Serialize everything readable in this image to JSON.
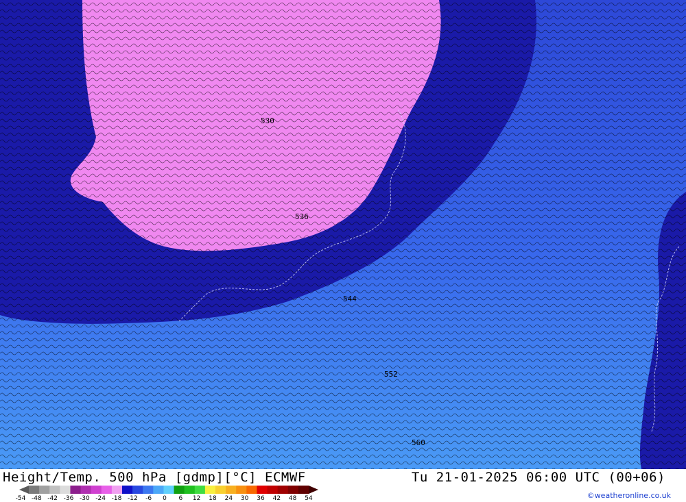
{
  "header": {
    "title": "Height/Temp. 500 hPa [gdmp][°C] ECMWF",
    "valid_time": "Tu 21-01-2025 06:00 UTC (00+06)",
    "credit": "©weatheronline.co.uk"
  },
  "legend": {
    "ticks": [
      "-54",
      "-48",
      "-42",
      "-36",
      "-30",
      "-24",
      "-18",
      "-12",
      "-6",
      "0",
      "6",
      "12",
      "18",
      "24",
      "30",
      "36",
      "42",
      "48",
      "54"
    ],
    "colors": [
      "#7b7b7b",
      "#a0a0a0",
      "#c0c0c0",
      "#dcdcdc",
      "#8c1e8c",
      "#b030b0",
      "#d040d0",
      "#e860e8",
      "#f0a0f0",
      "#1010c8",
      "#2848e0",
      "#3c78f0",
      "#4ca8f8",
      "#60d0fc",
      "#10a010",
      "#20c020",
      "#40dc40",
      "#f8f040",
      "#f8d030",
      "#f8b020",
      "#f89010",
      "#f86800",
      "#e00000",
      "#c00000",
      "#a00000",
      "#800000",
      "#600000"
    ]
  },
  "map": {
    "contour_labels": [
      "530",
      "536",
      "544",
      "552",
      "560"
    ],
    "fill_colors": {
      "coldest": "#f088f0",
      "cold": "#1a1aa8",
      "mid": "#2d4ee0",
      "warm": "#3b6cf0",
      "warmest": "#4a90f4"
    }
  }
}
